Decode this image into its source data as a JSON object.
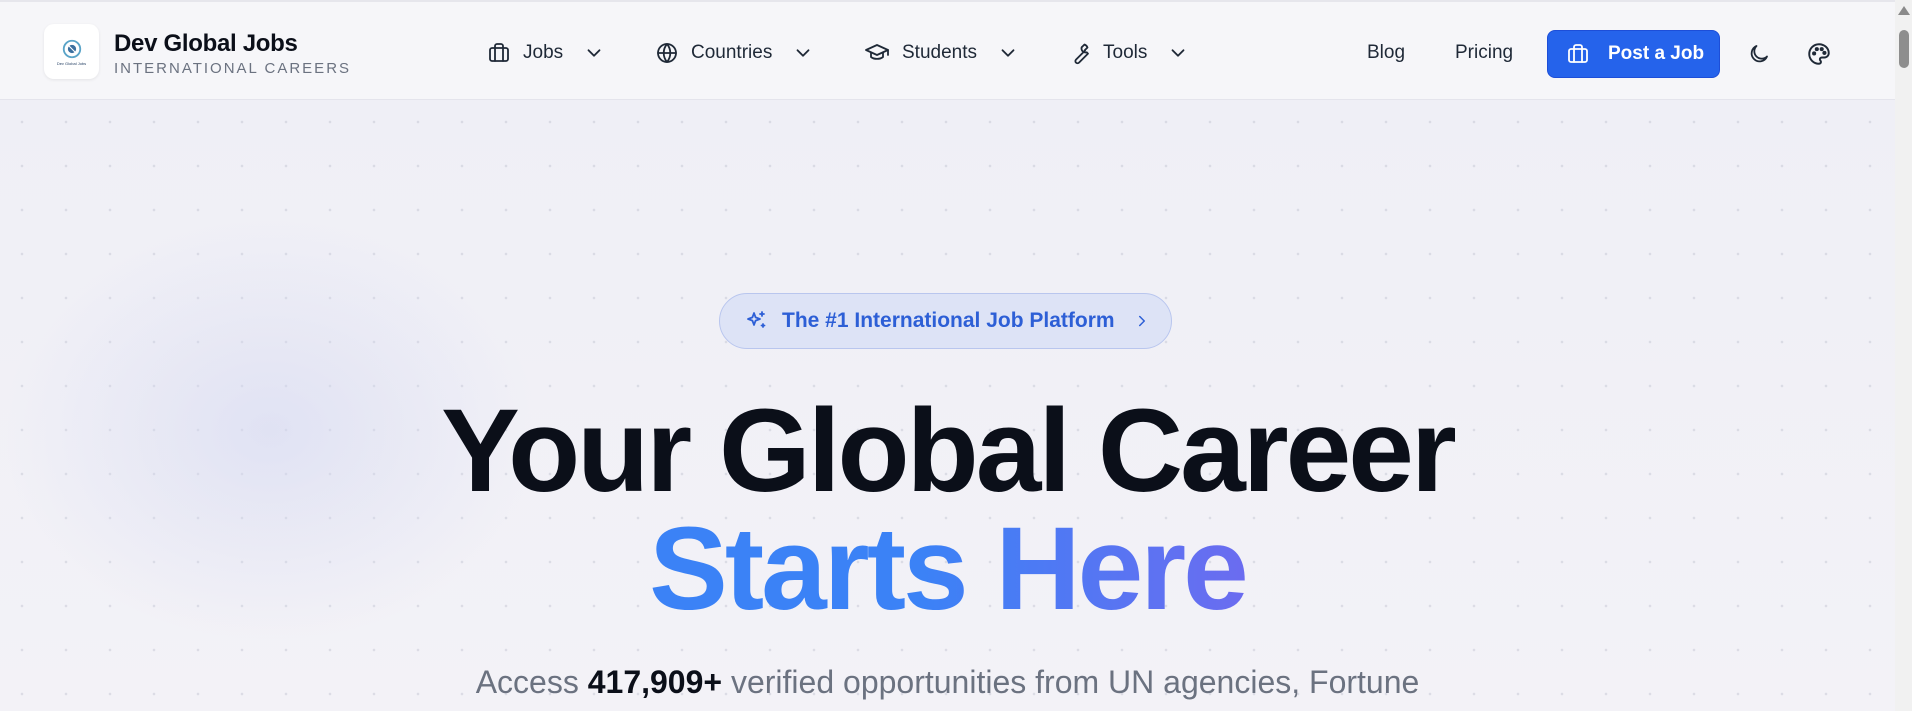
{
  "brand": {
    "name": "Dev Global Jobs",
    "tagline": "INTERNATIONAL CAREERS",
    "logo_text": "Dev Global Jobs"
  },
  "nav": {
    "items": [
      {
        "label": "Jobs",
        "icon": "briefcase-icon"
      },
      {
        "label": "Countries",
        "icon": "globe-icon"
      },
      {
        "label": "Students",
        "icon": "graduation-cap-icon"
      },
      {
        "label": "Tools",
        "icon": "wrench-icon"
      }
    ],
    "blog": "Blog",
    "pricing": "Pricing",
    "post_job": "Post a Job"
  },
  "hero": {
    "badge": "The #1 International Job Platform",
    "title_line1": "Your Global Career",
    "title_line2": "Starts Here",
    "subtitle_prefix": "Access ",
    "subtitle_count": "417,909+",
    "subtitle_suffix": " verified opportunities from UN agencies, Fortune"
  },
  "colors": {
    "accent": "#2563eb",
    "badge_text": "#2d5fd6",
    "gradient_start": "#3b82f6",
    "gradient_end": "#6b6cf0"
  }
}
